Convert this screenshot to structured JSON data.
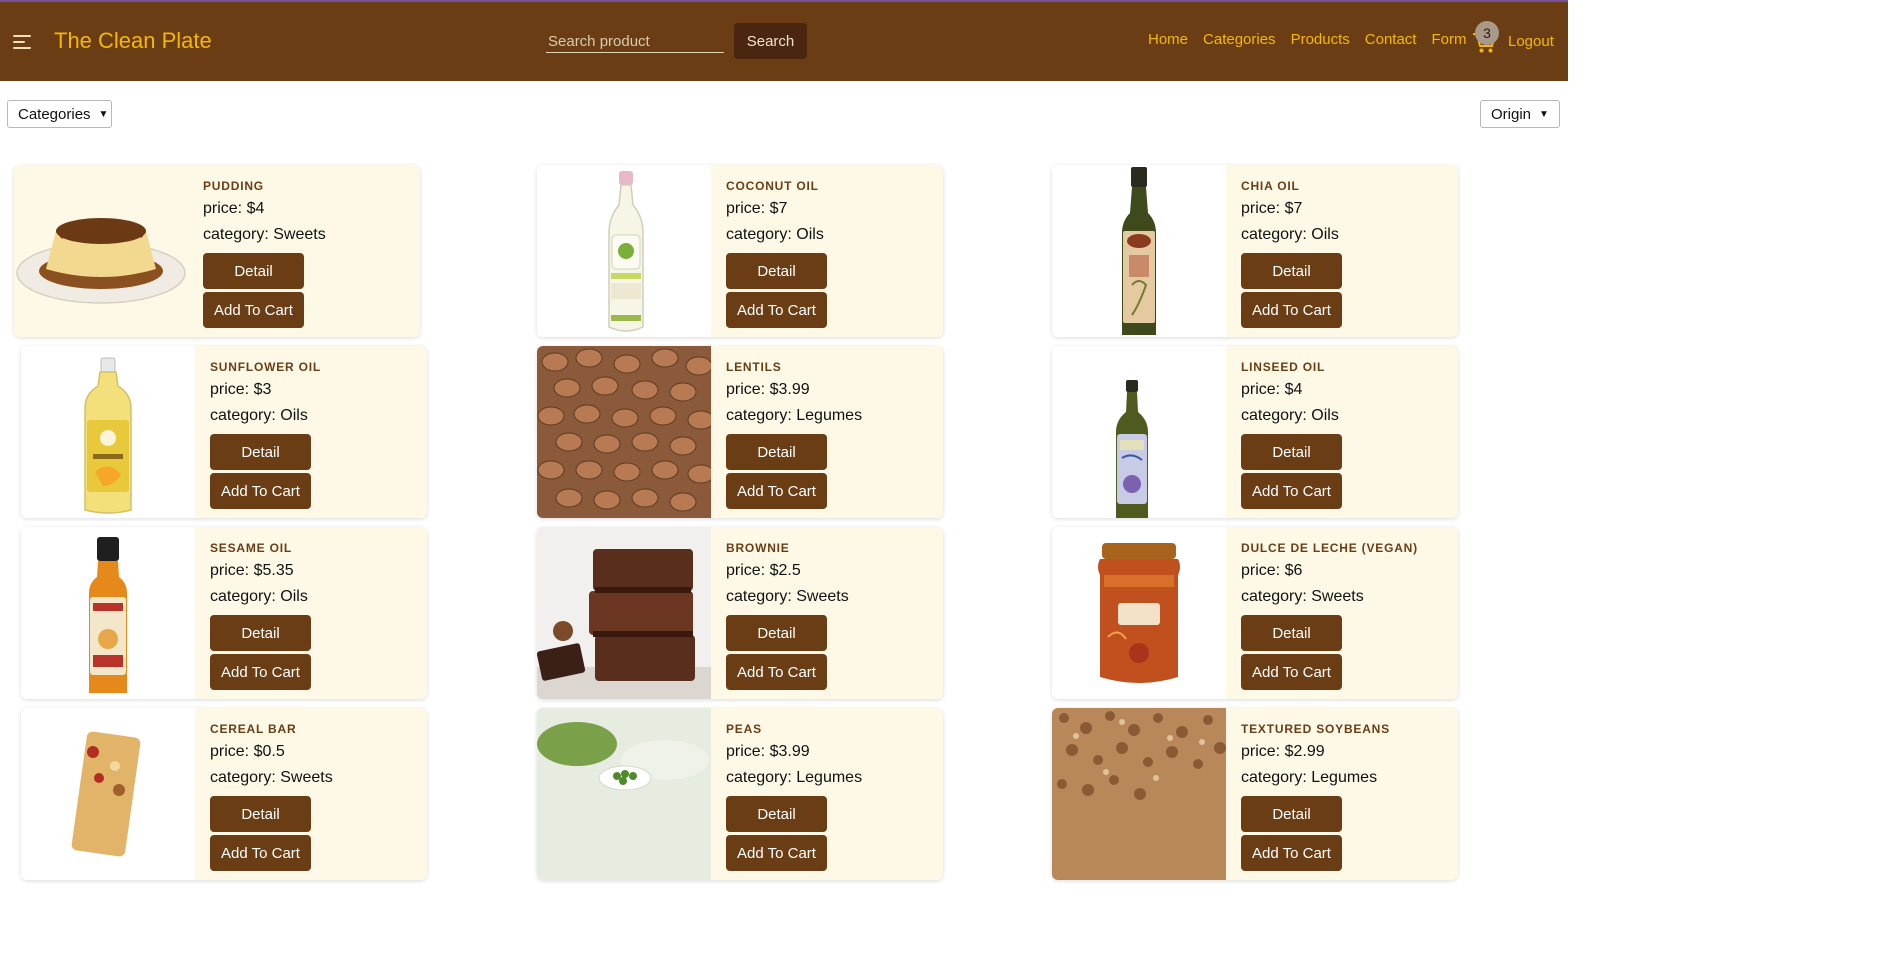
{
  "app": {
    "brand": "The Clean Plate",
    "search": {
      "placeholder": "Search product",
      "button_label": "Search"
    },
    "nav": [
      "Home",
      "Categories",
      "Products",
      "Contact",
      "Form"
    ],
    "cart_count": "3",
    "logout_label": "Logout"
  },
  "filters": {
    "categories_label": "Categories",
    "origin_label": "Origin"
  },
  "ui": {
    "detail_label": "Detail",
    "add_label": "Add To Cart"
  },
  "colors": {
    "navbar": "#6b3d14",
    "accent": "#f5b800",
    "card_bg": "#fef9e7",
    "button": "#6b3d14"
  },
  "products": [
    {
      "name": "PUDDING",
      "price": "price: $4",
      "category": "category: Sweets",
      "image": "pudding"
    },
    {
      "name": "COCONUT OIL",
      "price": "price: $7",
      "category": "category: Oils",
      "image": "coconut-oil-bottle"
    },
    {
      "name": "CHIA OIL",
      "price": "price: $7",
      "category": "category: Oils",
      "image": "chia-oil-bottle"
    },
    {
      "name": "SUNFLOWER OIL",
      "price": "price: $3",
      "category": "category: Oils",
      "image": "sunflower-oil-bottle"
    },
    {
      "name": "LENTILS",
      "price": "price: $3.99",
      "category": "category: Legumes",
      "image": "lentils"
    },
    {
      "name": "LINSEED OIL",
      "price": "price: $4",
      "category": "category: Oils",
      "image": "linseed-oil-bottle"
    },
    {
      "name": "SESAME OIL",
      "price": "price: $5.35",
      "category": "category: Oils",
      "image": "sesame-oil-bottle"
    },
    {
      "name": "BROWNIE",
      "price": "price: $2.5",
      "category": "category: Sweets",
      "image": "brownie"
    },
    {
      "name": "DULCE DE LECHE (VEGAN)",
      "price": "price: $6",
      "category": "category: Sweets",
      "image": "dulce-de-leche-jar"
    },
    {
      "name": "CEREAL BAR",
      "price": "price: $0.5",
      "category": "category: Sweets",
      "image": "cereal-bar"
    },
    {
      "name": "PEAS",
      "price": "price: $3.99",
      "category": "category: Legumes",
      "image": "peas"
    },
    {
      "name": "TEXTURED SOYBEANS",
      "price": "price: $2.99",
      "category": "category: Legumes",
      "image": "textured-soybeans"
    }
  ]
}
